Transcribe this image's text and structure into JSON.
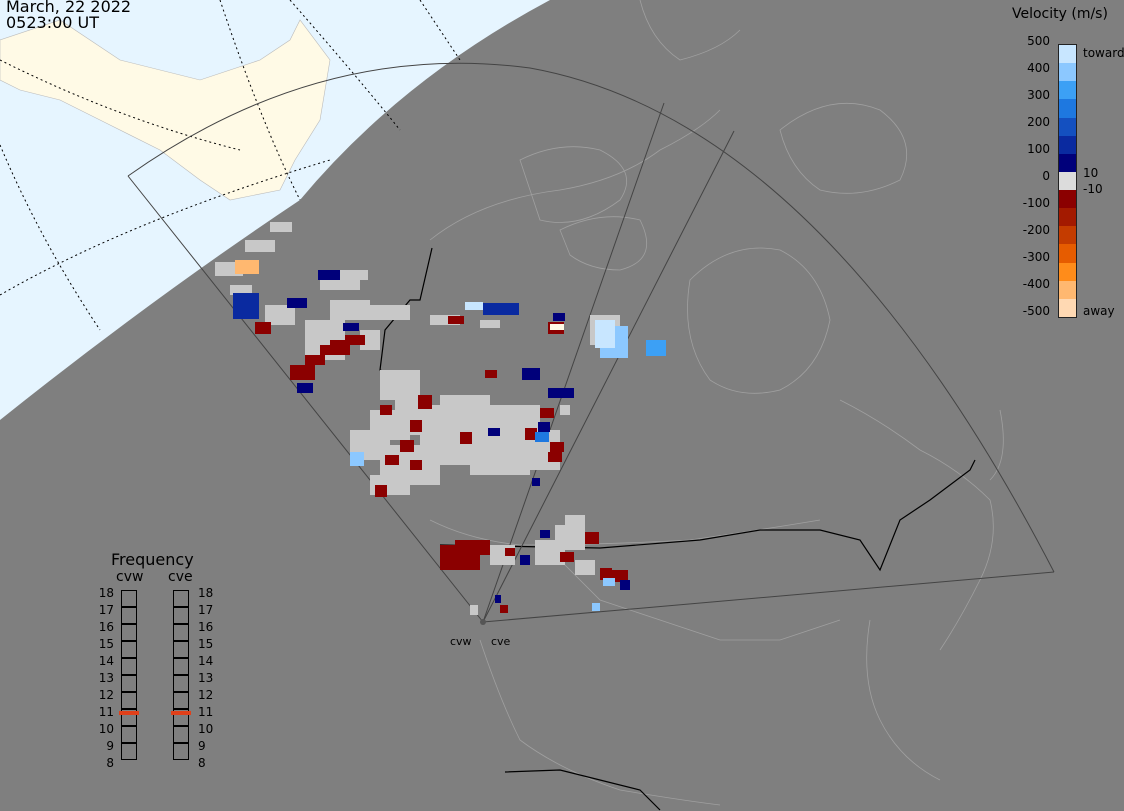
{
  "header": {
    "date": "March, 22 2022",
    "time": "0523:00 UT"
  },
  "colorbar": {
    "title": "Velocity (m/s)",
    "ticks": [
      "500",
      "400",
      "300",
      "200",
      "100",
      "0",
      "-100",
      "-200",
      "-300",
      "-400",
      "-500"
    ],
    "toward_label": "toward",
    "away_label": "away",
    "pos_threshold": "10",
    "neg_threshold": "-10",
    "colors": [
      "#ffd9b3",
      "#ffb870",
      "#ff8c1a",
      "#e65c00",
      "#c43c00",
      "#a31a00",
      "#8b0000",
      "#dcdcdc",
      "#00007a",
      "#0a2aa0",
      "#1450c0",
      "#1e78e0",
      "#3ca0f5",
      "#8cc8ff",
      "#c8e6ff"
    ]
  },
  "frequency": {
    "title": "Frequency",
    "radars": [
      "cvw",
      "cve"
    ],
    "levels": [
      "18",
      "17",
      "16",
      "15",
      "14",
      "13",
      "12",
      "11",
      "10",
      "9",
      "8"
    ],
    "cvw_freq": 11,
    "cve_freq": 11,
    "marker_color": "#e0401a"
  },
  "radars": [
    {
      "name": "cvw"
    },
    {
      "name": "cve"
    }
  ],
  "colors": {
    "land": "#7f7f7f",
    "daylight_land": "#fffae6",
    "daylight_sea": "#e6f5ff",
    "ground_scatter": "#c8c8c8"
  }
}
